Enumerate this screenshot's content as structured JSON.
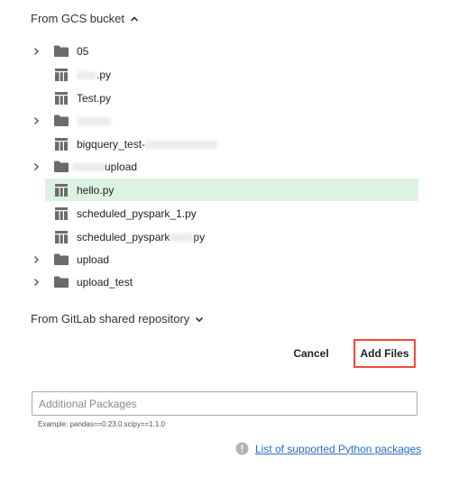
{
  "gcs": {
    "header": "From GCS bucket",
    "expanded_icon": "chevron-up-icon",
    "items": [
      {
        "type": "folder",
        "label": "05",
        "icon": "folder-icon"
      },
      {
        "type": "file",
        "label": ".py",
        "icon": "table-file-icon"
      },
      {
        "type": "file",
        "label": "Test.py",
        "icon": "table-file-icon"
      },
      {
        "type": "folder",
        "label": "",
        "icon": "folder-icon"
      },
      {
        "type": "file",
        "label": "bigquery_test-",
        "icon": "table-file-icon"
      },
      {
        "type": "folder",
        "label": "upload",
        "icon": "folder-icon"
      },
      {
        "type": "file",
        "label": "hello.py",
        "icon": "table-file-icon",
        "selected": true
      },
      {
        "type": "file",
        "label": "scheduled_pyspark_1.py",
        "icon": "table-file-icon"
      },
      {
        "type": "file",
        "label": "scheduled_pyspark",
        "suffix": "py",
        "icon": "table-file-icon"
      },
      {
        "type": "folder",
        "label": "upload",
        "icon": "folder-icon"
      },
      {
        "type": "folder",
        "label": "upload_test",
        "icon": "folder-icon"
      }
    ]
  },
  "gitlab": {
    "header": "From GitLab shared repository",
    "collapsed_icon": "chevron-down-icon"
  },
  "actions": {
    "cancel_label": "Cancel",
    "add_files_label": "Add Files"
  },
  "packages": {
    "placeholder": "Additional Packages",
    "value": "",
    "hint": "Example: pandas==0.23.0 scipy==1.1.0"
  },
  "supported": {
    "link_label": "List of supported Python packages",
    "icon": "info-icon"
  },
  "colors": {
    "selected_row": "#dcf3e2",
    "highlight_border": "#ee4c3f",
    "link": "#2b6cc4",
    "icon_gray": "#6b6b6b"
  }
}
